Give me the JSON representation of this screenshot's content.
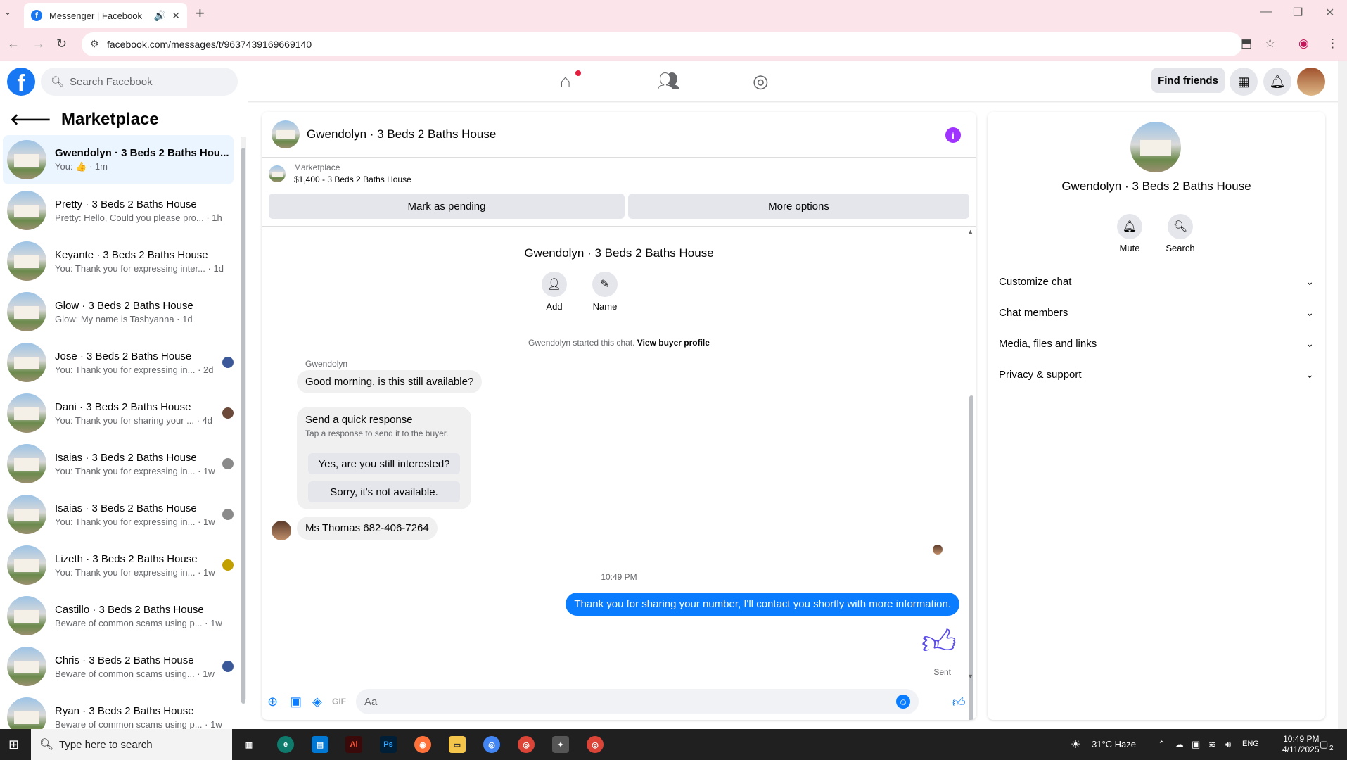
{
  "browser": {
    "tab_title": "Messenger | Facebook",
    "url": "facebook.com/messages/t/9637439169669140"
  },
  "fb_header": {
    "search_placeholder": "Search Facebook",
    "find_friends": "Find friends"
  },
  "sidebar": {
    "title": "Marketplace",
    "conversations": [
      {
        "name": "Gwendolyn · 3 Beds 2 Baths Hou...",
        "preview": "You: 👍 · 1m",
        "active": true
      },
      {
        "name": "Pretty · 3 Beds 2 Baths House",
        "preview": "Pretty: Hello, Could you please pro... · 1h"
      },
      {
        "name": "Keyante · 3 Beds 2 Baths House",
        "preview": "You: Thank you for expressing inter... · 1d"
      },
      {
        "name": "Glow · 3 Beds 2 Baths House",
        "preview": "Glow: My name is Tashyanna · 1d"
      },
      {
        "name": "Jose · 3 Beds 2 Baths House",
        "preview": "You: Thank you for expressing in... · 2d"
      },
      {
        "name": "Dani · 3 Beds 2 Baths House",
        "preview": "You: Thank you for sharing your ... · 4d"
      },
      {
        "name": "Isaias · 3 Beds 2 Baths House",
        "preview": "You: Thank you for expressing in... · 1w"
      },
      {
        "name": "Isaias · 3 Beds 2 Baths House",
        "preview": "You: Thank you for expressing in... · 1w"
      },
      {
        "name": "Lizeth · 3 Beds 2 Baths House",
        "preview": "You: Thank you for expressing in... · 1w"
      },
      {
        "name": "Castillo · 3 Beds 2 Baths House",
        "preview": "Beware of common scams using p... · 1w"
      },
      {
        "name": "Chris · 3 Beds 2 Baths House",
        "preview": "Beware of common scams using... · 1w"
      },
      {
        "name": "Ryan · 3 Beds 2 Baths House",
        "preview": "Beware of common scams using p... · 1w"
      }
    ]
  },
  "chat": {
    "title": "Gwendolyn · 3 Beds 2 Baths House",
    "marketplace_label": "Marketplace",
    "listing": "$1,400 - 3 Beds 2 Baths House",
    "mark_pending": "Mark as pending",
    "more_options": "More options",
    "center_title": "Gwendolyn · 3 Beds 2 Baths House",
    "add_label": "Add",
    "name_label": "Name",
    "started_text": "Gwendolyn started this chat.",
    "view_profile": "View buyer profile",
    "sender_name": "Gwendolyn",
    "msg1": "Good morning, is this still available?",
    "quick_title": "Send a quick response",
    "quick_sub": "Tap a response to send it to the buyer.",
    "quick_opt1": "Yes, are you still interested?",
    "quick_opt2": "Sorry, it's not available.",
    "msg2": "Ms Thomas 682-406-7264",
    "time": "10:49 PM",
    "out_msg": "Thank you for sharing your number, I'll contact you shortly with more information.",
    "sent_label": "Sent",
    "composer_placeholder": "Aa"
  },
  "info_panel": {
    "title": "Gwendolyn · 3 Beds 2 Baths House",
    "mute": "Mute",
    "search": "Search",
    "rows": [
      "Customize chat",
      "Chat members",
      "Media, files and links",
      "Privacy & support"
    ]
  },
  "taskbar": {
    "search_placeholder": "Type here to search",
    "weather": "31°C Haze",
    "lang": "ENG",
    "time": "10:49 PM",
    "date": "4/11/2025",
    "notif_count": "2"
  }
}
